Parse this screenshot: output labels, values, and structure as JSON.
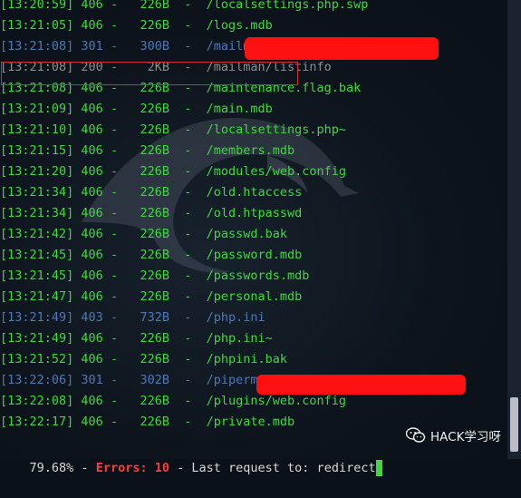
{
  "log_lines": [
    {
      "time": "[13:20:59]",
      "code": "406",
      "size": "226B",
      "path": "/localsettings.php.swp",
      "arrow": ""
    },
    {
      "time": "[13:21:05]",
      "code": "406",
      "size": "226B",
      "path": "/logs.mdb",
      "arrow": ""
    },
    {
      "time": "[13:21:08]",
      "code": "301",
      "size": "300B",
      "path": "/mailman",
      "arrow": "->"
    },
    {
      "time": "[13:21:08]",
      "code": "200",
      "size": "2KB",
      "path": "/mailman/listinfo",
      "arrow": ""
    },
    {
      "time": "[13:21:08]",
      "code": "406",
      "size": "226B",
      "path": "/maintenance.flag.bak",
      "arrow": ""
    },
    {
      "time": "[13:21:09]",
      "code": "406",
      "size": "226B",
      "path": "/main.mdb",
      "arrow": ""
    },
    {
      "time": "[13:21:10]",
      "code": "406",
      "size": "226B",
      "path": "/localsettings.php~",
      "arrow": ""
    },
    {
      "time": "[13:21:15]",
      "code": "406",
      "size": "226B",
      "path": "/members.mdb",
      "arrow": ""
    },
    {
      "time": "[13:21:20]",
      "code": "406",
      "size": "226B",
      "path": "/modules/web.config",
      "arrow": ""
    },
    {
      "time": "[13:21:34]",
      "code": "406",
      "size": "226B",
      "path": "/old.htaccess",
      "arrow": ""
    },
    {
      "time": "[13:21:34]",
      "code": "406",
      "size": "226B",
      "path": "/old.htpasswd",
      "arrow": ""
    },
    {
      "time": "[13:21:42]",
      "code": "406",
      "size": "226B",
      "path": "/passwd.bak",
      "arrow": ""
    },
    {
      "time": "[13:21:45]",
      "code": "406",
      "size": "226B",
      "path": "/password.mdb",
      "arrow": ""
    },
    {
      "time": "[13:21:45]",
      "code": "406",
      "size": "226B",
      "path": "/passwords.mdb",
      "arrow": ""
    },
    {
      "time": "[13:21:47]",
      "code": "406",
      "size": "226B",
      "path": "/personal.mdb",
      "arrow": ""
    },
    {
      "time": "[13:21:49]",
      "code": "403",
      "size": "732B",
      "path": "/php.ini",
      "arrow": ""
    },
    {
      "time": "[13:21:49]",
      "code": "406",
      "size": "226B",
      "path": "/php.ini~",
      "arrow": ""
    },
    {
      "time": "[13:21:52]",
      "code": "406",
      "size": "226B",
      "path": "/phpini.bak",
      "arrow": ""
    },
    {
      "time": "[13:22:06]",
      "code": "301",
      "size": "302B",
      "path": "/pipermail",
      "arrow": "->"
    },
    {
      "time": "[13:22:08]",
      "code": "406",
      "size": "226B",
      "path": "/plugins/web.config",
      "arrow": ""
    },
    {
      "time": "[13:22:17]",
      "code": "406",
      "size": "226B",
      "path": "/private.mdb",
      "arrow": ""
    }
  ],
  "status": {
    "progress": "79.68%",
    "errors_label": "Errors:",
    "errors_count": "10",
    "last_request": "Last request to: redirect"
  },
  "watermark": {
    "text": "HACK学习呀",
    "icon": "wechat-icon"
  },
  "colors": {
    "ok": "#3fd93f",
    "redirect": "#4f78b8",
    "error": "#ff3b3b",
    "redaction": "#ff1010",
    "selection_border": "#d03030"
  }
}
